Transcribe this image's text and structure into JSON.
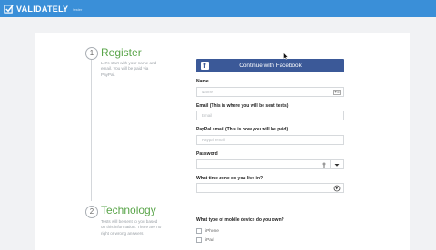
{
  "header": {
    "brand_name": "VALIDATELY",
    "brand_tag": "tester"
  },
  "steps": [
    {
      "number": "1",
      "title": "Register",
      "description": "Let's start with your name and email. You will be paid via PayPal."
    },
    {
      "number": "2",
      "title": "Technology",
      "description": "Tests will be sent to you based on this information. There are no right or wrong answers."
    }
  ],
  "form": {
    "facebook_button": "Continue with Facebook",
    "name": {
      "label": "Name",
      "placeholder": "Name"
    },
    "email": {
      "label": "Email (This is where you will be sent tests)",
      "placeholder": "Email"
    },
    "paypal": {
      "label": "PayPal email (This is how you will be paid)",
      "placeholder": "Paypal email"
    },
    "password": {
      "label": "Password",
      "placeholder": ""
    },
    "timezone": {
      "label": "What time zone do you live in?",
      "placeholder": ""
    },
    "device_question": "What type of mobile device do you own?",
    "device_options": [
      "iPhone",
      "iPad"
    ]
  },
  "colors": {
    "topbar": "#3a8fd8",
    "step_title": "#5aa54a",
    "facebook": "#3b5998"
  },
  "icons": {
    "brand": "checkbox-logo-icon",
    "name_field": "contact-card-icon",
    "password_visibility": "eye-icon",
    "password_toggle": "caret-down-icon",
    "timezone": "globe-icon"
  }
}
